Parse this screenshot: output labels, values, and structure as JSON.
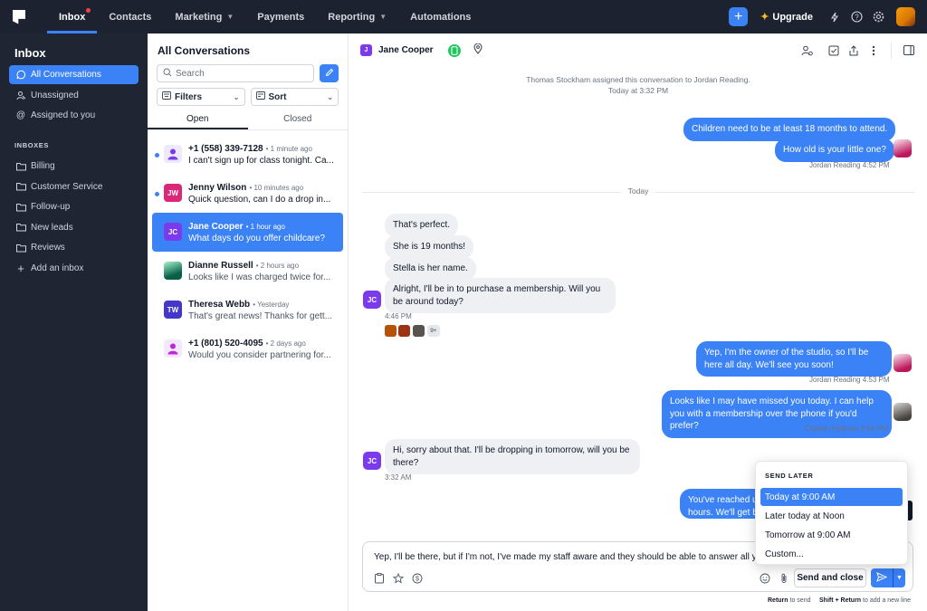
{
  "topnav": {
    "items": [
      {
        "label": "Inbox",
        "active": true,
        "has_dot": true
      },
      {
        "label": "Contacts"
      },
      {
        "label": "Marketing",
        "dropdown": true
      },
      {
        "label": "Payments"
      },
      {
        "label": "Reporting",
        "dropdown": true
      },
      {
        "label": "Automations"
      }
    ],
    "upgrade_label": "Upgrade",
    "icons": [
      "plus-icon",
      "sparkle-icon",
      "lightning-icon",
      "help-icon",
      "gear-icon",
      "user-avatar"
    ]
  },
  "sidebar": {
    "title": "Inbox",
    "items": [
      {
        "label": "All Conversations",
        "icon": "chat-icon",
        "active": true
      },
      {
        "label": "Unassigned",
        "icon": "unassigned-icon"
      },
      {
        "label": "Assigned to you",
        "icon": "at-icon"
      }
    ],
    "inboxes_heading": "INBOXES",
    "inboxes": [
      {
        "label": "Billing",
        "icon": "folder-icon"
      },
      {
        "label": "Customer Service",
        "icon": "folder-icon"
      },
      {
        "label": "Follow-up",
        "icon": "folder-icon"
      },
      {
        "label": "New leads",
        "icon": "folder-icon"
      },
      {
        "label": "Reviews",
        "icon": "folder-icon"
      },
      {
        "label": "Add an inbox",
        "icon": "plus-icon"
      }
    ]
  },
  "conversations": {
    "title": "All Conversations",
    "search_placeholder": "Search",
    "filters_label": "Filters",
    "sort_label": "Sort",
    "tabs": [
      "Open",
      "Closed"
    ],
    "items": [
      {
        "name": "+1 (558) 339-7128",
        "time": "1 minute ago",
        "preview": "I can't sign up for class tonight. Ca...",
        "unread": true
      },
      {
        "name": "Jenny Wilson",
        "initials": "JW",
        "time": "10 minutes ago",
        "preview": "Quick question, can I do a drop in...",
        "unread": true
      },
      {
        "name": "Jane Cooper",
        "initials": "JC",
        "time": "1 hour ago",
        "preview": "What days do you offer childcare?",
        "active": true
      },
      {
        "name": "Dianne Russell",
        "time": "2 hours ago",
        "preview": "Looks like I was charged twice for..."
      },
      {
        "name": "Theresa Webb",
        "initials": "TW",
        "time": "Yesterday",
        "preview": "That's great news! Thanks for gett..."
      },
      {
        "name": "+1 (801) 520-4095",
        "time": "2 days ago",
        "preview": "Would you consider partnering for..."
      }
    ]
  },
  "thread": {
    "contact_initial": "J",
    "contact_name": "Jane Cooper",
    "system_line1": "Thomas Stockham assigned this conversation to Jordan Reading.",
    "system_line2": "Today at 3:32 PM",
    "out1": "Children need to be at least 18 months to attend.",
    "out2": "How old is your little one?",
    "meta1": "Jordan Reading 4:52 PM",
    "today_label": "Today",
    "in1": "That's perfect.",
    "in2": "She is 19 months!",
    "in3": "Stella is her name.",
    "in4": "Alright, I'll be in to purchase a membership. Will you be around today?",
    "in_initials": "JC",
    "in_time1": "4:46 PM",
    "more_viewers": "9+",
    "out3": "Yep, I'm the owner of the studio, so I'll be here all day. We'll see you soon!",
    "meta2": "Jordan Reading 4:53 PM",
    "out4": "Looks like I may have missed you today. I can help you with a membership over the phone if you'd prefer?",
    "meta3": "Colleen Hoffman 4:54 PM",
    "in5": "Hi, sorry about that. I'll be dropping in tomorrow, will you be there?",
    "in_time2": "3:32 AM",
    "out5_partial1": "You've reached u",
    "out5_partial2": "hours. We'll get b"
  },
  "composer": {
    "text": "Yep, I'll be there, but if I'm not, I've made my staff aware and they should be able to answer all you",
    "send_close_label": "Send and close",
    "hint_return_key": "Return",
    "hint_return_text": "to send",
    "hint_shift_key": "Shift + Return",
    "hint_shift_text": "to add a new line"
  },
  "send_later": {
    "title": "SEND LATER",
    "options": [
      {
        "label": "Today at 9:00 AM",
        "active": true
      },
      {
        "label": "Later today at Noon"
      },
      {
        "label": "Tomorrow at 9:00 AM"
      },
      {
        "label": "Custom..."
      }
    ]
  },
  "colors": {
    "accent": "#3b82f6",
    "nav": "#1c2230",
    "sidebar": "#1f2533"
  }
}
